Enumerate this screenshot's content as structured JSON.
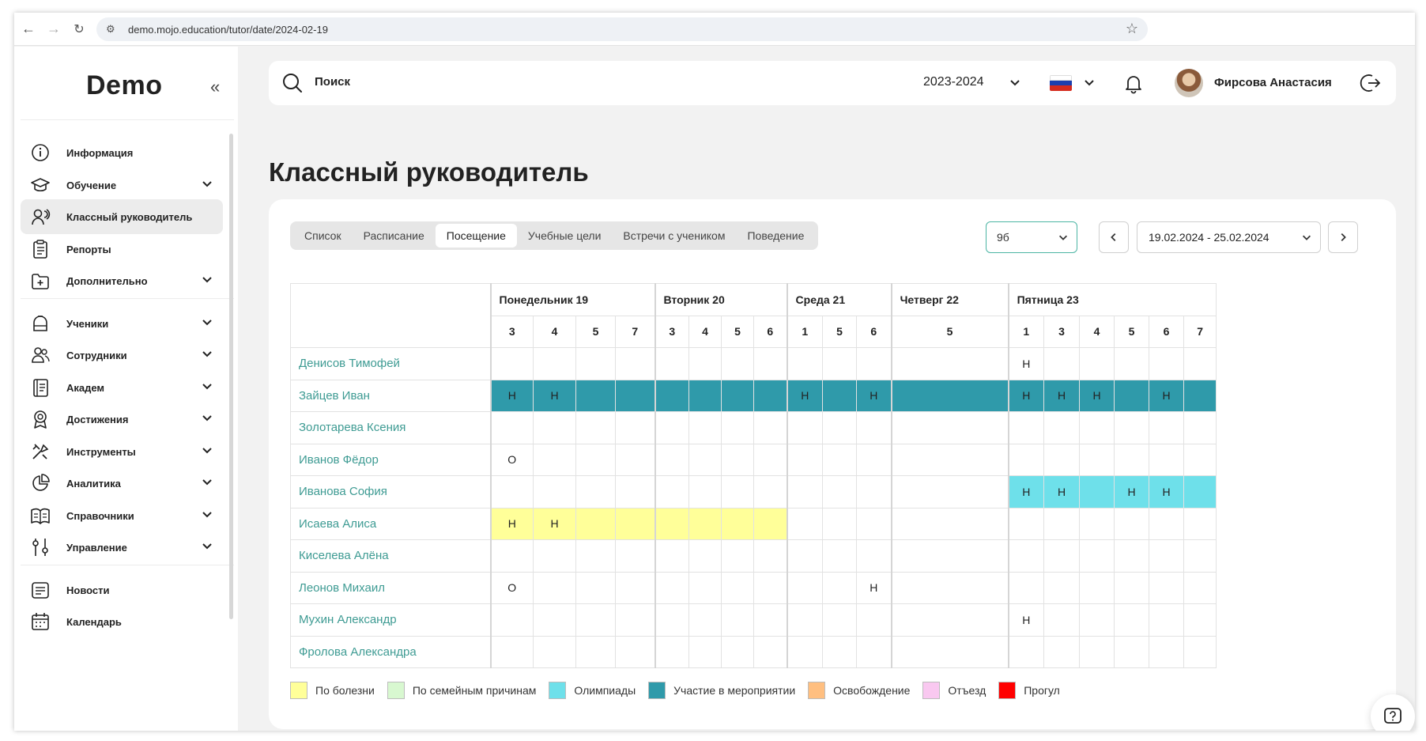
{
  "browser": {
    "url": "demo.mojo.education/tutor/date/2024-02-19"
  },
  "sidebar": {
    "logo": "Demo",
    "items": [
      {
        "label": "Информация",
        "icon": "info-icon",
        "chevron": false,
        "active": false
      },
      {
        "label": "Обучение",
        "icon": "graduation-cap-icon",
        "chevron": true,
        "active": false
      },
      {
        "label": "Классный руководитель",
        "icon": "tutor-icon",
        "chevron": false,
        "active": true
      },
      {
        "label": "Репорты",
        "icon": "clipboard-icon",
        "chevron": false,
        "active": false
      },
      {
        "label": "Дополнительно",
        "icon": "folder-plus-icon",
        "chevron": true,
        "active": false
      },
      {
        "label": "Ученики",
        "icon": "backpack-icon",
        "chevron": true,
        "active": false
      },
      {
        "label": "Сотрудники",
        "icon": "users-icon",
        "chevron": true,
        "active": false
      },
      {
        "label": "Академ",
        "icon": "book-icon",
        "chevron": true,
        "active": false
      },
      {
        "label": "Достижения",
        "icon": "award-icon",
        "chevron": true,
        "active": false
      },
      {
        "label": "Инструменты",
        "icon": "tools-icon",
        "chevron": true,
        "active": false
      },
      {
        "label": "Аналитика",
        "icon": "pie-chart-icon",
        "chevron": true,
        "active": false
      },
      {
        "label": "Справочники",
        "icon": "open-book-icon",
        "chevron": true,
        "active": false
      },
      {
        "label": "Управление",
        "icon": "sliders-icon",
        "chevron": true,
        "active": false
      },
      {
        "label": "Новости",
        "icon": "news-icon",
        "chevron": false,
        "active": false
      },
      {
        "label": "Календарь",
        "icon": "calendar-icon",
        "chevron": false,
        "active": false
      }
    ]
  },
  "header": {
    "search_label": "Поиск",
    "year": "2023-2024",
    "user_name": "Фирсова Анастасия"
  },
  "page": {
    "title": "Классный руководитель"
  },
  "tabs": [
    {
      "label": "Список",
      "active": false
    },
    {
      "label": "Расписание",
      "active": false
    },
    {
      "label": "Посещение",
      "active": true
    },
    {
      "label": "Учебные цели",
      "active": false
    },
    {
      "label": "Встречи с учеником",
      "active": false
    },
    {
      "label": "Поведение",
      "active": false
    }
  ],
  "filters": {
    "class_value": "9б",
    "date_range": "19.02.2024 - 25.02.2024"
  },
  "colors": {
    "illness": "#ffff99",
    "family": "#d8f8d0",
    "olympiad": "#6ee0ea",
    "event": "#2f9aaa",
    "exemption": "#ffbf80",
    "departure": "#f9c8f0",
    "truancy": "#ff0000",
    "accent": "#3e9b93"
  },
  "attendance": {
    "days": [
      {
        "label": "Понедельник 19",
        "lessons": [
          "3",
          "4",
          "5",
          "7"
        ]
      },
      {
        "label": "Вторник 20",
        "lessons": [
          "3",
          "4",
          "5",
          "6"
        ]
      },
      {
        "label": "Среда 21",
        "lessons": [
          "1",
          "5",
          "6"
        ]
      },
      {
        "label": "Четверг 22",
        "lessons": [
          "5"
        ]
      },
      {
        "label": "Пятница 23",
        "lessons": [
          "1",
          "3",
          "4",
          "5",
          "6",
          "7"
        ]
      }
    ],
    "students": [
      {
        "name": "Денисов Тимофей",
        "cells": [
          {
            "t": "",
            "c": null
          },
          {
            "t": "",
            "c": null
          },
          {
            "t": "",
            "c": null
          },
          {
            "t": "",
            "c": null
          },
          {
            "t": "",
            "c": null
          },
          {
            "t": "",
            "c": null
          },
          {
            "t": "",
            "c": null
          },
          {
            "t": "",
            "c": null
          },
          {
            "t": "",
            "c": null
          },
          {
            "t": "",
            "c": null
          },
          {
            "t": "",
            "c": null
          },
          {
            "t": "",
            "c": null
          },
          {
            "t": "Н",
            "c": null
          },
          {
            "t": "",
            "c": null
          },
          {
            "t": "",
            "c": null
          },
          {
            "t": "",
            "c": null
          },
          {
            "t": "",
            "c": null
          },
          {
            "t": "",
            "c": null
          }
        ]
      },
      {
        "name": "Зайцев Иван",
        "cells": [
          {
            "t": "Н",
            "c": "event"
          },
          {
            "t": "Н",
            "c": "event"
          },
          {
            "t": "",
            "c": "event"
          },
          {
            "t": "",
            "c": "event"
          },
          {
            "t": "",
            "c": "event"
          },
          {
            "t": "",
            "c": "event"
          },
          {
            "t": "",
            "c": "event"
          },
          {
            "t": "",
            "c": "event"
          },
          {
            "t": "Н",
            "c": "event"
          },
          {
            "t": "",
            "c": "event"
          },
          {
            "t": "Н",
            "c": "event"
          },
          {
            "t": "",
            "c": "event"
          },
          {
            "t": "Н",
            "c": "event"
          },
          {
            "t": "Н",
            "c": "event"
          },
          {
            "t": "Н",
            "c": "event"
          },
          {
            "t": "",
            "c": "event"
          },
          {
            "t": "Н",
            "c": "event"
          },
          {
            "t": "",
            "c": "event"
          }
        ]
      },
      {
        "name": "Золотарева Ксения",
        "cells": [
          {
            "t": "",
            "c": null
          },
          {
            "t": "",
            "c": null
          },
          {
            "t": "",
            "c": null
          },
          {
            "t": "",
            "c": null
          },
          {
            "t": "",
            "c": null
          },
          {
            "t": "",
            "c": null
          },
          {
            "t": "",
            "c": null
          },
          {
            "t": "",
            "c": null
          },
          {
            "t": "",
            "c": null
          },
          {
            "t": "",
            "c": null
          },
          {
            "t": "",
            "c": null
          },
          {
            "t": "",
            "c": null
          },
          {
            "t": "",
            "c": null
          },
          {
            "t": "",
            "c": null
          },
          {
            "t": "",
            "c": null
          },
          {
            "t": "",
            "c": null
          },
          {
            "t": "",
            "c": null
          },
          {
            "t": "",
            "c": null
          }
        ]
      },
      {
        "name": "Иванов Фёдор",
        "cells": [
          {
            "t": "О",
            "c": null
          },
          {
            "t": "",
            "c": null
          },
          {
            "t": "",
            "c": null
          },
          {
            "t": "",
            "c": null
          },
          {
            "t": "",
            "c": null
          },
          {
            "t": "",
            "c": null
          },
          {
            "t": "",
            "c": null
          },
          {
            "t": "",
            "c": null
          },
          {
            "t": "",
            "c": null
          },
          {
            "t": "",
            "c": null
          },
          {
            "t": "",
            "c": null
          },
          {
            "t": "",
            "c": null
          },
          {
            "t": "",
            "c": null
          },
          {
            "t": "",
            "c": null
          },
          {
            "t": "",
            "c": null
          },
          {
            "t": "",
            "c": null
          },
          {
            "t": "",
            "c": null
          },
          {
            "t": "",
            "c": null
          }
        ]
      },
      {
        "name": "Иванова София",
        "cells": [
          {
            "t": "",
            "c": null
          },
          {
            "t": "",
            "c": null
          },
          {
            "t": "",
            "c": null
          },
          {
            "t": "",
            "c": null
          },
          {
            "t": "",
            "c": null
          },
          {
            "t": "",
            "c": null
          },
          {
            "t": "",
            "c": null
          },
          {
            "t": "",
            "c": null
          },
          {
            "t": "",
            "c": null
          },
          {
            "t": "",
            "c": null
          },
          {
            "t": "",
            "c": null
          },
          {
            "t": "",
            "c": null
          },
          {
            "t": "Н",
            "c": "olympiad"
          },
          {
            "t": "Н",
            "c": "olympiad"
          },
          {
            "t": "",
            "c": "olympiad"
          },
          {
            "t": "Н",
            "c": "olympiad"
          },
          {
            "t": "Н",
            "c": "olympiad"
          },
          {
            "t": "",
            "c": "olympiad"
          }
        ]
      },
      {
        "name": "Исаева Алиса",
        "cells": [
          {
            "t": "Н",
            "c": "illness"
          },
          {
            "t": "Н",
            "c": "illness"
          },
          {
            "t": "",
            "c": "illness"
          },
          {
            "t": "",
            "c": "illness"
          },
          {
            "t": "",
            "c": "illness"
          },
          {
            "t": "",
            "c": "illness"
          },
          {
            "t": "",
            "c": "illness"
          },
          {
            "t": "",
            "c": "illness"
          },
          {
            "t": "",
            "c": null
          },
          {
            "t": "",
            "c": null
          },
          {
            "t": "",
            "c": null
          },
          {
            "t": "",
            "c": null
          },
          {
            "t": "",
            "c": null
          },
          {
            "t": "",
            "c": null
          },
          {
            "t": "",
            "c": null
          },
          {
            "t": "",
            "c": null
          },
          {
            "t": "",
            "c": null
          },
          {
            "t": "",
            "c": null
          }
        ]
      },
      {
        "name": "Киселева Алёна",
        "cells": [
          {
            "t": "",
            "c": null
          },
          {
            "t": "",
            "c": null
          },
          {
            "t": "",
            "c": null
          },
          {
            "t": "",
            "c": null
          },
          {
            "t": "",
            "c": null
          },
          {
            "t": "",
            "c": null
          },
          {
            "t": "",
            "c": null
          },
          {
            "t": "",
            "c": null
          },
          {
            "t": "",
            "c": null
          },
          {
            "t": "",
            "c": null
          },
          {
            "t": "",
            "c": null
          },
          {
            "t": "",
            "c": null
          },
          {
            "t": "",
            "c": null
          },
          {
            "t": "",
            "c": null
          },
          {
            "t": "",
            "c": null
          },
          {
            "t": "",
            "c": null
          },
          {
            "t": "",
            "c": null
          },
          {
            "t": "",
            "c": null
          }
        ]
      },
      {
        "name": "Леонов Михаил",
        "cells": [
          {
            "t": "О",
            "c": null
          },
          {
            "t": "",
            "c": null
          },
          {
            "t": "",
            "c": null
          },
          {
            "t": "",
            "c": null
          },
          {
            "t": "",
            "c": null
          },
          {
            "t": "",
            "c": null
          },
          {
            "t": "",
            "c": null
          },
          {
            "t": "",
            "c": null
          },
          {
            "t": "",
            "c": null
          },
          {
            "t": "",
            "c": null
          },
          {
            "t": "Н",
            "c": null
          },
          {
            "t": "",
            "c": null
          },
          {
            "t": "",
            "c": null
          },
          {
            "t": "",
            "c": null
          },
          {
            "t": "",
            "c": null
          },
          {
            "t": "",
            "c": null
          },
          {
            "t": "",
            "c": null
          },
          {
            "t": "",
            "c": null
          }
        ]
      },
      {
        "name": "Мухин Александр",
        "cells": [
          {
            "t": "",
            "c": null
          },
          {
            "t": "",
            "c": null
          },
          {
            "t": "",
            "c": null
          },
          {
            "t": "",
            "c": null
          },
          {
            "t": "",
            "c": null
          },
          {
            "t": "",
            "c": null
          },
          {
            "t": "",
            "c": null
          },
          {
            "t": "",
            "c": null
          },
          {
            "t": "",
            "c": null
          },
          {
            "t": "",
            "c": null
          },
          {
            "t": "",
            "c": null
          },
          {
            "t": "",
            "c": null
          },
          {
            "t": "Н",
            "c": null
          },
          {
            "t": "",
            "c": null
          },
          {
            "t": "",
            "c": null
          },
          {
            "t": "",
            "c": null
          },
          {
            "t": "",
            "c": null
          },
          {
            "t": "",
            "c": null
          }
        ]
      },
      {
        "name": "Фролова Александра",
        "cells": [
          {
            "t": "",
            "c": null
          },
          {
            "t": "",
            "c": null
          },
          {
            "t": "",
            "c": null
          },
          {
            "t": "",
            "c": null
          },
          {
            "t": "",
            "c": null
          },
          {
            "t": "",
            "c": null
          },
          {
            "t": "",
            "c": null
          },
          {
            "t": "",
            "c": null
          },
          {
            "t": "",
            "c": null
          },
          {
            "t": "",
            "c": null
          },
          {
            "t": "",
            "c": null
          },
          {
            "t": "",
            "c": null
          },
          {
            "t": "",
            "c": null
          },
          {
            "t": "",
            "c": null
          },
          {
            "t": "",
            "c": null
          },
          {
            "t": "",
            "c": null
          },
          {
            "t": "",
            "c": null
          },
          {
            "t": "",
            "c": null
          }
        ]
      }
    ]
  },
  "legend": [
    {
      "label": "По болезни",
      "color": "#ffff99"
    },
    {
      "label": "По семейным причинам",
      "color": "#d8f8d0"
    },
    {
      "label": "Олимпиады",
      "color": "#6ee0ea"
    },
    {
      "label": "Участие в мероприятии",
      "color": "#2f9aaa"
    },
    {
      "label": "Освобождение",
      "color": "#ffbf80"
    },
    {
      "label": "Отъезд",
      "color": "#f9c8f0"
    },
    {
      "label": "Прогул",
      "color": "#ff0000"
    }
  ]
}
